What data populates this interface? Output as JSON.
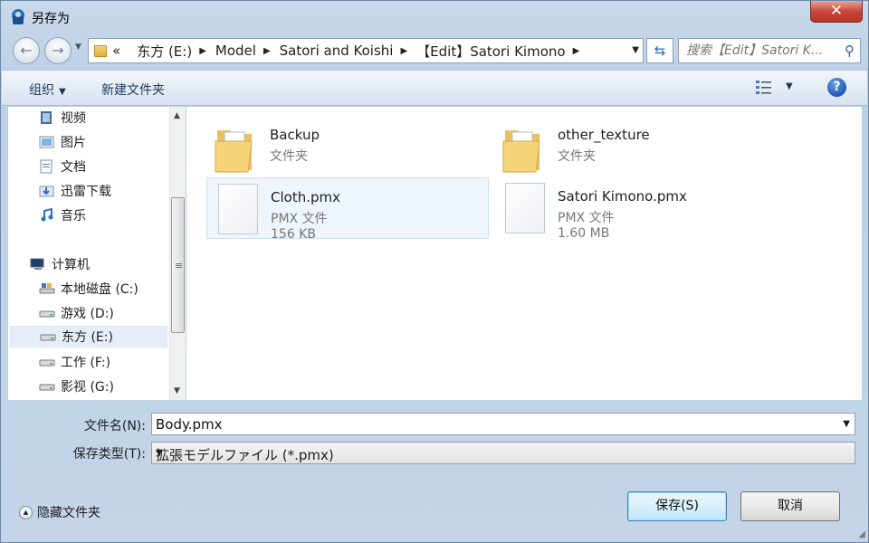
{
  "window": {
    "title": "另存为",
    "close_label": "✕"
  },
  "address": {
    "crumbs": [
      "«",
      "东方 (E:)",
      "Model",
      "Satori and Koishi",
      "【Edit】Satori Kimono"
    ]
  },
  "search": {
    "placeholder": "搜索【Edit】Satori K..."
  },
  "toolbar": {
    "organize": "组织",
    "new_folder": "新建文件夹",
    "help": "?"
  },
  "nav": {
    "items": [
      {
        "label": "视频",
        "icon": "video-library-icon"
      },
      {
        "label": "图片",
        "icon": "pictures-library-icon"
      },
      {
        "label": "文档",
        "icon": "documents-library-icon"
      },
      {
        "label": "迅雷下载",
        "icon": "downloads-folder-icon"
      },
      {
        "label": "音乐",
        "icon": "music-library-icon"
      },
      {
        "label": "计算机",
        "icon": "computer-icon"
      },
      {
        "label": "本地磁盘 (C:)",
        "icon": "system-drive-icon"
      },
      {
        "label": "游戏 (D:)",
        "icon": "drive-icon"
      },
      {
        "label": "东方 (E:)",
        "icon": "drive-icon",
        "selected": true
      },
      {
        "label": "工作 (F:)",
        "icon": "drive-icon"
      },
      {
        "label": "影视 (G:)",
        "icon": "drive-icon"
      }
    ]
  },
  "files": [
    {
      "name": "Backup",
      "type": "文件夹",
      "kind": "folder"
    },
    {
      "name": "other_texture",
      "type": "文件夹",
      "kind": "folder"
    },
    {
      "name": "Cloth.pmx",
      "type": "PMX 文件",
      "size": "156 KB",
      "kind": "file",
      "selected": true
    },
    {
      "name": "Satori Kimono.pmx",
      "type": "PMX 文件",
      "size": "1.60 MB",
      "kind": "file"
    }
  ],
  "form": {
    "filename_label": "文件名(N):",
    "filename_value": "Body.pmx",
    "filetype_label": "保存类型(T):",
    "filetype_value": "拡張モデルファイル (*.pmx)"
  },
  "footer": {
    "hide_folders": "隐藏文件夹",
    "save": "保存(S)",
    "cancel": "取消"
  },
  "colors": {
    "accent": "#3c7fb1",
    "selection": "#e5eef8",
    "close": "#c9483a"
  }
}
